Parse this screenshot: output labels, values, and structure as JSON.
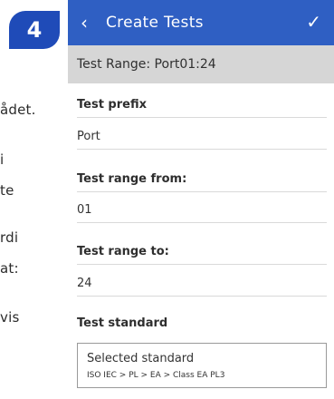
{
  "manual": {
    "step_number": "4",
    "fragments": [
      "ådet.",
      "i",
      "te",
      "rdi",
      "at:",
      "vis"
    ]
  },
  "app": {
    "title": "Create Tests",
    "back_icon": "chevron-left-icon",
    "confirm_icon": "check-icon",
    "range_summary": "Test Range: Port01:24",
    "fields": {
      "prefix_label": "Test prefix",
      "prefix_value": "Port",
      "range_from_label": "Test range from:",
      "range_from_value": "01",
      "range_to_label": "Test range to:",
      "range_to_value": "24",
      "standard_label": "Test standard",
      "standard_box_title": "Selected standard",
      "standard_path": "ISO IEC > PL > EA > Class EA PL3"
    },
    "colors": {
      "app_bar": "#2f5fc3",
      "badge": "#1f4bb8",
      "range_bar": "#d6d6d6"
    }
  }
}
